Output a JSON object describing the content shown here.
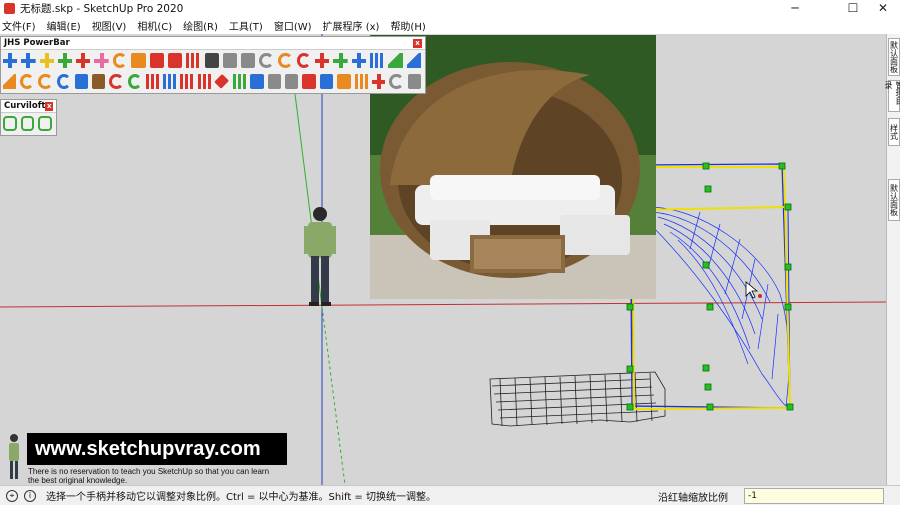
{
  "window": {
    "title": "无标题.skp - SketchUp Pro 2020",
    "minimize_glyph": "─",
    "maximize_glyph": "☐",
    "close_glyph": "✕"
  },
  "menu": [
    "文件(F)",
    "编辑(E)",
    "视图(V)",
    "相机(C)",
    "绘图(R)",
    "工具(T)",
    "窗口(W)",
    "扩展程序 (x)",
    "帮助(H)"
  ],
  "toolbars": {
    "jhs": {
      "title": "JHS PowerBar",
      "close": "x",
      "row1_icons": [
        "blue-box-icon",
        "blue-box-icon",
        "yellow-box-icon",
        "green-box-icon",
        "red-box-icon",
        "pink-box-icon",
        "orange-sphere-icon",
        "orange-cube-icon",
        "red-cube-icon",
        "red-square-icon",
        "red-grid-icon",
        "dark-cube-icon",
        "grey-link-icon",
        "grey-brush-icon",
        "grey-curve-icon",
        "orange-curve-icon",
        "red-curve-icon",
        "red-cross-icon",
        "green-cross-icon",
        "blue-cross-icon",
        "blue-grid-icon",
        "green-cone-icon",
        "blue-cone-icon"
      ],
      "row2_icons": [
        "orange-triangle-icon",
        "orange-rotate-icon",
        "orange-arc-icon",
        "blue-arc-icon",
        "blue-move-icon",
        "brown-cylinder-icon",
        "red-curve-arrow-icon",
        "green-rotate-icon",
        "red-multi-icon",
        "blue-multi-icon",
        "red-multi-icon",
        "red-dots-icon",
        "red-diamond-icon",
        "green-grid-icon",
        "blue-arrows-icon",
        "grey-arrows-icon",
        "grey-arrows-icon",
        "red-arrows-icon",
        "blue-arrows-icon",
        "orange-square-icon",
        "orange-grid-icon",
        "red-x-icon",
        "grey-arc-icon",
        "grey-polygon-icon"
      ]
    },
    "curviloft": {
      "title": "Curviloft",
      "close": "x",
      "icons": [
        "loft-icon",
        "loft-path-icon",
        "loft-skin-icon"
      ]
    }
  },
  "right_tabs": [
    "默认面板",
    "管理目录",
    "样式",
    "默认面板"
  ],
  "overlay": {
    "website": "www.sketchupvray.com",
    "caption_line1": "There is no reservation to teach you SketchUp so that you can learn",
    "caption_line2": "the best original knowledge."
  },
  "status": {
    "message": "选择一个手柄并移动它以调整对象比例。Ctrl = 以中心为基准。Shift = 切换统一调整。",
    "measure_label": "沿红轴缩放比例",
    "measure_value": "-1"
  },
  "colors": {
    "accent_red": "#d9342b",
    "selection_blue": "#2030d0",
    "bbox_yellow": "#f0e000",
    "handle_green": "#22c022",
    "axis_red": "#c03030",
    "axis_green": "#30b030",
    "axis_blue": "#2040c0"
  }
}
